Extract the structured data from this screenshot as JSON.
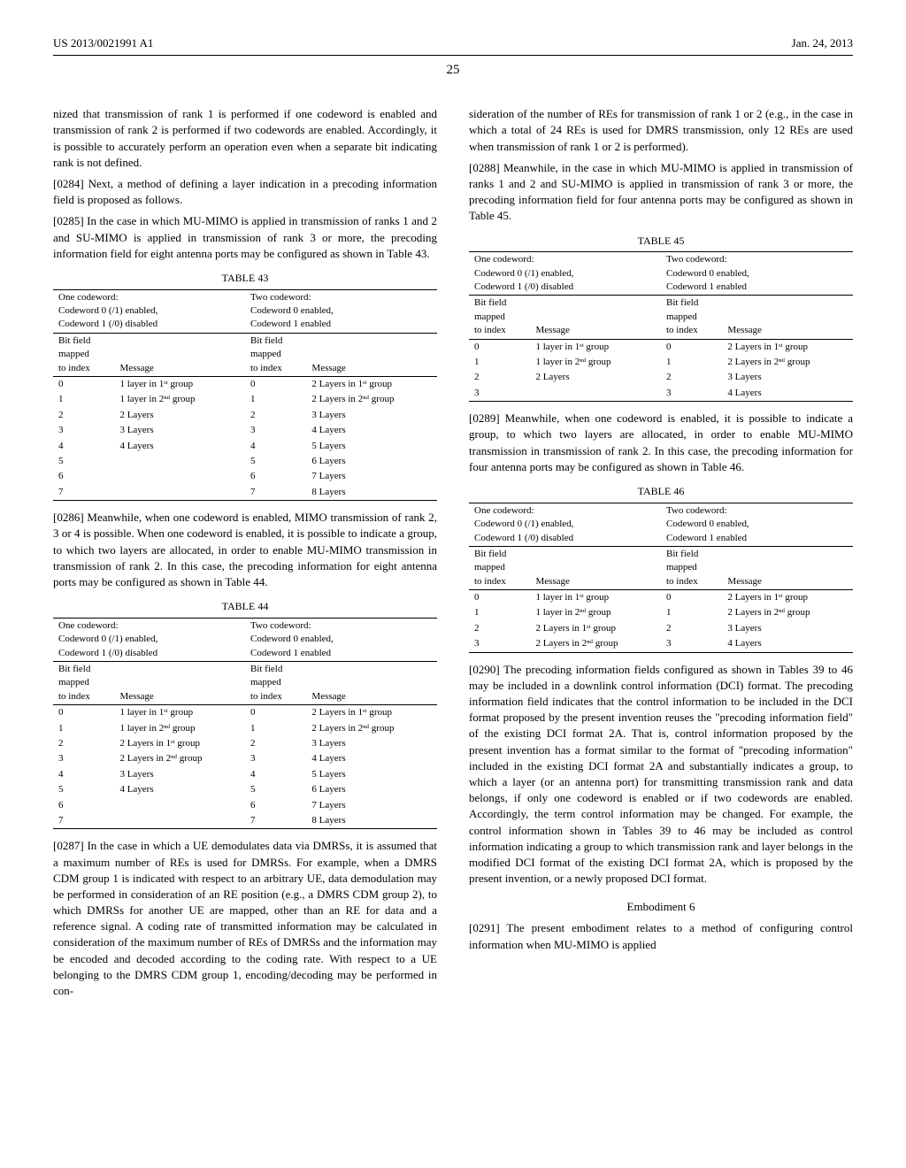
{
  "header": {
    "left": "US 2013/0021991 A1",
    "right": "Jan. 24, 2013"
  },
  "page_number": "25",
  "col1": {
    "para_intro": "nized that transmission of rank 1 is performed if one codeword is enabled and transmission of rank 2 is performed if two codewords are enabled. Accordingly, it is possible to accurately perform an operation even when a separate bit indicating rank is not defined.",
    "p0284_num": "[0284]",
    "p0284": " Next, a method of defining a layer indication in a precoding information field is proposed as follows.",
    "p0285_num": "[0285]",
    "p0285": " In the case in which MU-MIMO is applied in transmission of ranks 1 and 2 and SU-MIMO is applied in transmission of rank 3 or more, the precoding information field for eight antenna ports may be configured as shown in Table 43.",
    "p0286_num": "[0286]",
    "p0286": " Meanwhile, when one codeword is enabled, MIMO transmission of rank 2, 3 or 4 is possible. When one codeword is enabled, it is possible to indicate a group, to which two layers are allocated, in order to enable MU-MIMO transmission in transmission of rank 2. In this case, the precoding information for eight antenna ports may be configured as shown in Table 44.",
    "p0287_num": "[0287]",
    "p0287": " In the case in which a UE demodulates data via DMRSs, it is assumed that a maximum number of REs is used for DMRSs. For example, when a DMRS CDM group 1 is indicated with respect to an arbitrary UE, data demodulation may be performed in consideration of an RE position (e.g., a DMRS CDM group 2), to which DMRSs for another UE are mapped, other than an RE for data and a reference signal. A coding rate of transmitted information may be calculated in consideration of the maximum number of REs of DMRSs and the information may be encoded and decoded according to the coding rate. With respect to a UE belonging to the DMRS CDM group 1, encoding/decoding may be performed in con-"
  },
  "col2": {
    "p_cont": "sideration of the number of REs for transmission of rank 1 or 2 (e.g., in the case in which a total of 24 REs is used for DMRS transmission, only 12 REs are used when transmission of rank 1 or 2 is performed).",
    "p0288_num": "[0288]",
    "p0288": " Meanwhile, in the case in which MU-MIMO is applied in transmission of ranks 1 and 2 and SU-MIMO is applied in transmission of rank 3 or more, the precoding information field for four antenna ports may be configured as shown in Table 45.",
    "p0289_num": "[0289]",
    "p0289": " Meanwhile, when one codeword is enabled, it is possible to indicate a group, to which two layers are allocated, in order to enable MU-MIMO transmission in transmission of rank 2. In this case, the precoding information for four antenna ports may be configured as shown in Table 46.",
    "p0290_num": "[0290]",
    "p0290": " The precoding information fields configured as shown in Tables 39 to 46 may be included in a downlink control information (DCI) format. The precoding information field indicates that the control information to be included in the DCI format proposed by the present invention reuses the \"precoding information field\" of the existing DCI format 2A. That is, control information proposed by the present invention has a format similar to the format of \"precoding information\" included in the existing DCI format 2A and substantially indicates a group, to which a layer (or an antenna port) for transmitting transmission rank and data belongs, if only one codeword is enabled or if two codewords are enabled. Accordingly, the term control information may be changed. For example, the control information shown in Tables 39 to 46 may be included as control information indicating a group to which transmission rank and layer belongs in the modified DCI format of the existing DCI format 2A, which is proposed by the present invention, or a newly proposed DCI format.",
    "embodiment": "Embodiment 6",
    "p0291_num": "[0291]",
    "p0291": " The present embodiment relates to a method of configuring control information when MU-MIMO is applied"
  },
  "tables": {
    "t43": {
      "caption": "TABLE 43",
      "group1": "One codeword:\nCodeword 0 (/1) enabled,\nCodeword 1 (/0) disabled",
      "group2": "Two codeword:\nCodeword 0 enabled,\nCodeword 1 enabled",
      "col_bit": "Bit field\nmapped\nto index",
      "col_msg": "Message",
      "rows1": [
        {
          "idx": "0",
          "msg": "1 layer in 1ˢᵗ group"
        },
        {
          "idx": "1",
          "msg": "1 layer in 2ⁿᵈ group"
        },
        {
          "idx": "2",
          "msg": "2 Layers"
        },
        {
          "idx": "3",
          "msg": "3 Layers"
        },
        {
          "idx": "4",
          "msg": "4 Layers"
        },
        {
          "idx": "5",
          "msg": ""
        },
        {
          "idx": "6",
          "msg": ""
        },
        {
          "idx": "7",
          "msg": ""
        }
      ],
      "rows2": [
        {
          "idx": "0",
          "msg": "2 Layers in 1ˢᵗ group"
        },
        {
          "idx": "1",
          "msg": "2 Layers in 2ⁿᵈ group"
        },
        {
          "idx": "2",
          "msg": "3 Layers"
        },
        {
          "idx": "3",
          "msg": "4 Layers"
        },
        {
          "idx": "4",
          "msg": "5 Layers"
        },
        {
          "idx": "5",
          "msg": "6 Layers"
        },
        {
          "idx": "6",
          "msg": "7 Layers"
        },
        {
          "idx": "7",
          "msg": "8 Layers"
        }
      ]
    },
    "t44": {
      "caption": "TABLE 44",
      "rows1": [
        {
          "idx": "0",
          "msg": "1 layer in 1ˢᵗ group"
        },
        {
          "idx": "1",
          "msg": "1 layer in 2ⁿᵈ group"
        },
        {
          "idx": "2",
          "msg": "2 Layers in 1ˢᵗ group"
        },
        {
          "idx": "3",
          "msg": "2 Layers in 2ⁿᵈ group"
        },
        {
          "idx": "4",
          "msg": "3 Layers"
        },
        {
          "idx": "5",
          "msg": "4 Layers"
        },
        {
          "idx": "6",
          "msg": ""
        },
        {
          "idx": "7",
          "msg": ""
        }
      ],
      "rows2": [
        {
          "idx": "0",
          "msg": "2 Layers in 1ˢᵗ group"
        },
        {
          "idx": "1",
          "msg": "2 Layers in 2ⁿᵈ group"
        },
        {
          "idx": "2",
          "msg": "3 Layers"
        },
        {
          "idx": "3",
          "msg": "4 Layers"
        },
        {
          "idx": "4",
          "msg": "5 Layers"
        },
        {
          "idx": "5",
          "msg": "6 Layers"
        },
        {
          "idx": "6",
          "msg": "7 Layers"
        },
        {
          "idx": "7",
          "msg": "8 Layers"
        }
      ]
    },
    "t45": {
      "caption": "TABLE 45",
      "rows1": [
        {
          "idx": "0",
          "msg": "1 layer in 1ˢᵗ group"
        },
        {
          "idx": "1",
          "msg": "1 layer in 2ⁿᵈ group"
        },
        {
          "idx": "2",
          "msg": "2 Layers"
        },
        {
          "idx": "3",
          "msg": ""
        }
      ],
      "rows2": [
        {
          "idx": "0",
          "msg": "2 Layers in 1ˢᵗ group"
        },
        {
          "idx": "1",
          "msg": "2 Layers in 2ⁿᵈ group"
        },
        {
          "idx": "2",
          "msg": "3 Layers"
        },
        {
          "idx": "3",
          "msg": "4 Layers"
        }
      ]
    },
    "t46": {
      "caption": "TABLE 46",
      "rows1": [
        {
          "idx": "0",
          "msg": "1 layer in 1ˢᵗ group"
        },
        {
          "idx": "1",
          "msg": "1 layer in 2ⁿᵈ group"
        },
        {
          "idx": "2",
          "msg": "2 Layers in 1ˢᵗ group"
        },
        {
          "idx": "3",
          "msg": "2 Layers in 2ⁿᵈ group"
        }
      ],
      "rows2": [
        {
          "idx": "0",
          "msg": "2 Layers in 1ˢᵗ group"
        },
        {
          "idx": "1",
          "msg": "2 Layers in 2ⁿᵈ group"
        },
        {
          "idx": "2",
          "msg": "3 Layers"
        },
        {
          "idx": "3",
          "msg": "4 Layers"
        }
      ]
    }
  }
}
